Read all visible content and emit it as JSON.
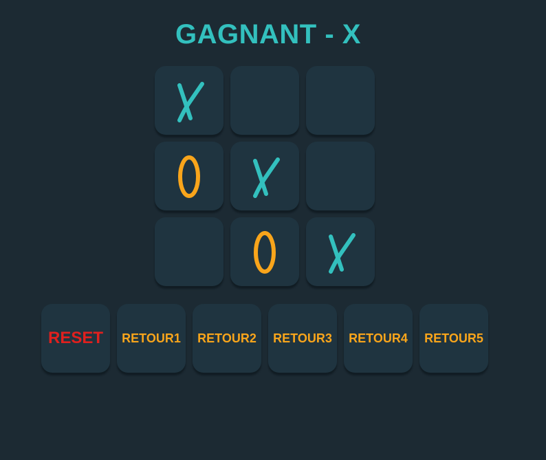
{
  "status": {
    "title": "GAGNANT - X"
  },
  "colors": {
    "background": "#1c2a33",
    "tile": "#1f3440",
    "x_mark": "#33c0be",
    "o_mark": "#f9a51b",
    "reset_label": "#e0201e",
    "retour_label": "#f9a51b"
  },
  "board": {
    "cells": [
      "X",
      "",
      "",
      "O",
      "X",
      "",
      "",
      "O",
      "X"
    ]
  },
  "controls": {
    "reset_label": "RESET",
    "retour1_label": "RETOUR1",
    "retour2_label": "RETOUR2",
    "retour3_label": "RETOUR3",
    "retour4_label": "RETOUR4",
    "retour5_label": "RETOUR5"
  }
}
